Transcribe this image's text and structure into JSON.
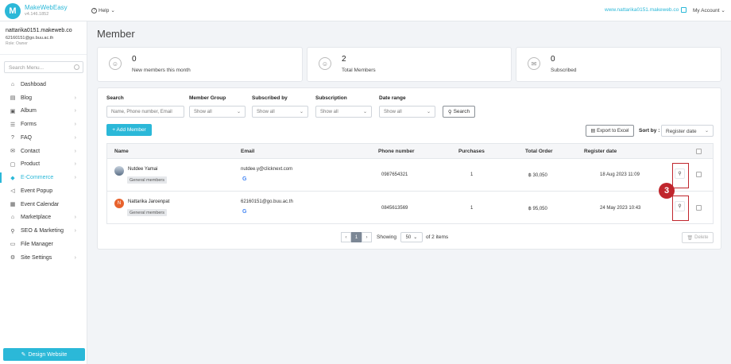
{
  "app": {
    "logo_letter": "M",
    "name": "MakeWebEasy",
    "version": "v4.146.1852"
  },
  "topbar": {
    "help_label": "Help",
    "site_url": "www.nattarika0151.makeweb.co",
    "account_label": "My Account"
  },
  "user": {
    "site": "nattarika0151.makeweb.co",
    "email": "62160151@go.buu.ac.th",
    "role": "Role: Owner"
  },
  "sidebar": {
    "search_placeholder": "Search Menu...",
    "items": [
      {
        "label": "Dashboad",
        "icon": "⌂",
        "chevron": ""
      },
      {
        "label": "Blog",
        "icon": "▤",
        "chevron": "›"
      },
      {
        "label": "Album",
        "icon": "▣",
        "chevron": "›"
      },
      {
        "label": "Forms",
        "icon": "☰",
        "chevron": "›"
      },
      {
        "label": "FAQ",
        "icon": "?",
        "chevron": "›"
      },
      {
        "label": "Contact",
        "icon": "✉",
        "chevron": "›"
      },
      {
        "label": "Product",
        "icon": "▢",
        "chevron": "›"
      },
      {
        "label": "E-Commerce",
        "icon": "◆",
        "chevron": "›"
      },
      {
        "label": "Event Popup",
        "icon": "◁",
        "chevron": ""
      },
      {
        "label": "Event Calendar",
        "icon": "▦",
        "chevron": ""
      },
      {
        "label": "Marketplace",
        "icon": "⌂",
        "chevron": "›"
      },
      {
        "label": "SEO & Marketing",
        "icon": "⚲",
        "chevron": "›"
      },
      {
        "label": "File Manager",
        "icon": "▭",
        "chevron": ""
      },
      {
        "label": "Site Settings",
        "icon": "⚙",
        "chevron": "›"
      }
    ],
    "design_button": "Design Website"
  },
  "page": {
    "title": "Member"
  },
  "stats": [
    {
      "value": "0",
      "label": "New members this month",
      "icon": "user-icon"
    },
    {
      "value": "2",
      "label": "Total Members",
      "icon": "users-icon"
    },
    {
      "value": "0",
      "label": "Subscribed",
      "icon": "mail-icon"
    }
  ],
  "filters": {
    "search_label": "Search",
    "search_placeholder": "Name, Phone number, Email",
    "group_label": "Member Group",
    "group_value": "Show all",
    "subscribed_by_label": "Subscribed by",
    "subscribed_by_value": "Show all",
    "subscription_label": "Subscription",
    "subscription_value": "Show all",
    "date_range_label": "Date range",
    "date_range_value": "Show all",
    "search_button": "Search"
  },
  "toolbar": {
    "add_member": "+ Add Member",
    "export_excel": "Export to Excel",
    "sort_by_label": "Sort by :",
    "sort_by_value": "Register date"
  },
  "table": {
    "headers": [
      "Name",
      "Email",
      "Phone number",
      "Purchases",
      "Total Order",
      "Register date"
    ],
    "rows": [
      {
        "name": "Nutdee Yamai",
        "group": "General members",
        "email": "nutdee.y@clicknext.com",
        "login_provider": "G",
        "phone": "0987654321",
        "purchases": "1",
        "total_order": "฿ 30,050",
        "register_date": "18 Aug 2023 11:09",
        "avatar_letter": "",
        "avatar_color": "#5b6f86"
      },
      {
        "name": "Nattarika Jaroenpat",
        "group": "General members",
        "email": "62160151@go.buu.ac.th",
        "login_provider": "G",
        "phone": "0845613569",
        "purchases": "1",
        "total_order": "฿ 95,050",
        "register_date": "24 May 2023 10:43",
        "avatar_letter": "N",
        "avatar_color": "#e8622c"
      }
    ]
  },
  "pagination": {
    "current_page": "1",
    "showing_label": "Showing",
    "page_size": "50",
    "of_items": "of 2 items",
    "delete_label": "Delete"
  },
  "annotation": {
    "step": "3",
    "color": "#c0262d"
  },
  "colors": {
    "accent": "#2bb8d8",
    "highlight": "#c0262d"
  }
}
